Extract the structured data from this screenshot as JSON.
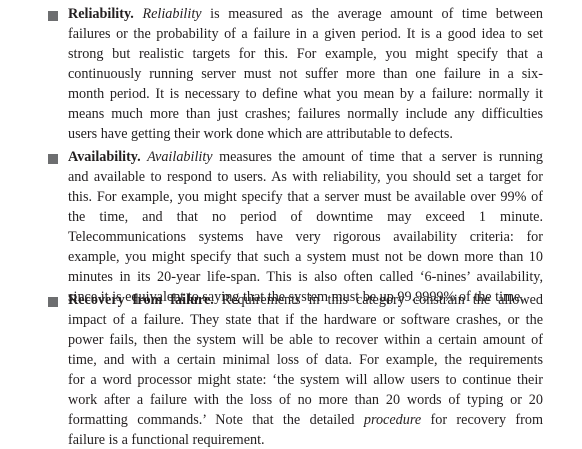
{
  "items": [
    {
      "term": "Reliability",
      "term_punct": ".",
      "italic_term": "Reliability",
      "lines": [
        " is measured as the average amount of time between",
        "failures or the probability of a failure in a given period. It is a good idea to set",
        "strong but realistic targets for this. For example, you might specify that a",
        "continuously running server must not suffer more than one failure in a six-",
        "month period. It is necessary to define what you mean by a failure: normally it",
        "means much more than just crashes; failures normally include any difficulties",
        "users have getting their work done which are attributable to defects."
      ]
    },
    {
      "term": "Availability",
      "term_punct": ".",
      "italic_term": "Availability",
      "lines": [
        " measures the amount of time that a server is running",
        "and available to respond to users. As with reliability, you should set a target for",
        "this. For example, you might specify that a server must be available over 99% of",
        "the time, and that no period of downtime may exceed 1 minute.",
        "Telecommunications systems have very rigorous availability criteria: for",
        "example, you might specify that such a system must not be down more than 10",
        "minutes in its 20-year life-span. This is also often called ‘6-nines’ availability,",
        "since it is equivalent to saying that the system must be up 99.9999% of the time."
      ]
    },
    {
      "term": "Recovery from failure",
      "term_punct": ".",
      "lines": [
        " Requirements in this category constrain the allowed",
        "impact of a failure. They state that if the hardware or software crashes, or the",
        "power fails, then the system will be able to recover within a certain amount of",
        "time, and with a certain minimal loss of data. For example, the requirements",
        "for a word processor might state: ‘the system will allow users to continue their",
        "work after a failure with the loss of no more than 20 words of typing or 20",
        "formatting commands.’ Note that the detailed ",
        "failure is a functional requirement."
      ],
      "italic_word": "procedure",
      "after_italic": " for recovery from"
    }
  ]
}
